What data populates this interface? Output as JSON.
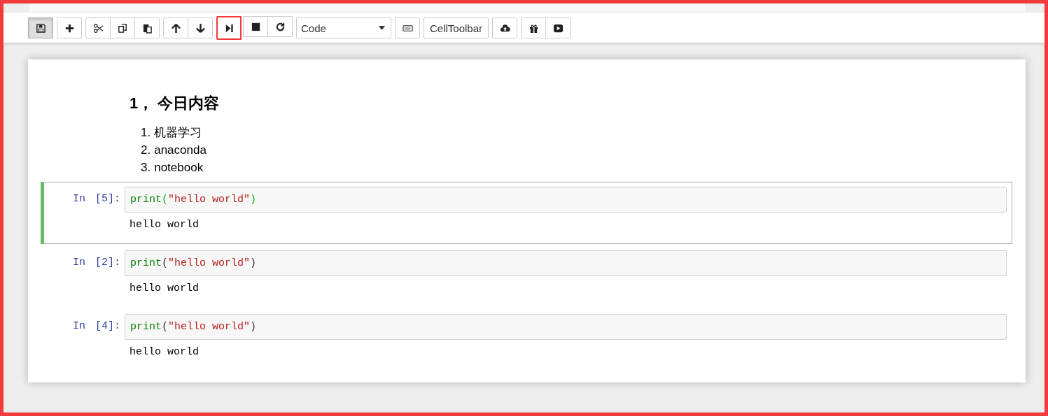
{
  "toolbar": {
    "groups": [
      {
        "buttons": [
          {
            "kind": "icon",
            "pressed": true,
            "highlighted": false
          }
        ]
      },
      {
        "buttons": [
          {
            "kind": "icon",
            "pressed": false,
            "highlighted": false
          }
        ]
      },
      {
        "buttons": [
          {
            "kind": "icon",
            "pressed": false,
            "highlighted": false
          },
          {
            "kind": "icon",
            "pressed": false,
            "highlighted": false
          },
          {
            "kind": "icon",
            "pressed": false,
            "highlighted": false
          }
        ]
      },
      {
        "buttons": [
          {
            "kind": "icon",
            "pressed": false,
            "highlighted": false
          },
          {
            "kind": "icon",
            "pressed": false,
            "highlighted": false
          }
        ]
      },
      {
        "buttons": [
          {
            "kind": "icon",
            "pressed": false,
            "highlighted": true
          },
          {
            "kind": "icon",
            "pressed": false,
            "highlighted": false
          },
          {
            "kind": "icon",
            "pressed": false,
            "highlighted": false
          }
        ]
      },
      {
        "buttons": [
          {
            "kind": "select",
            "value": "Code"
          }
        ]
      },
      {
        "buttons": [
          {
            "kind": "icon",
            "pressed": false,
            "highlighted": false
          }
        ]
      },
      {
        "buttons": [
          {
            "kind": "text",
            "label": "CellToolbar"
          }
        ]
      },
      {
        "buttons": [
          {
            "kind": "icon",
            "pressed": false,
            "highlighted": false
          }
        ]
      },
      {
        "buttons": [
          {
            "kind": "icon",
            "pressed": false,
            "highlighted": false
          },
          {
            "kind": "icon",
            "pressed": false,
            "highlighted": false
          }
        ]
      }
    ]
  },
  "markdown": {
    "heading": "1， 今日内容",
    "items": [
      {
        "number": "1.",
        "text": "机器学习"
      },
      {
        "number": "2.",
        "text": "anaconda"
      },
      {
        "number": "3.",
        "text": "notebook"
      }
    ]
  },
  "cells": [
    {
      "selected": true,
      "prompt": "In",
      "count": "[5]:",
      "func": "print",
      "open": "(",
      "string": "\"hello world\"",
      "close": ")",
      "output": "hello world"
    },
    {
      "selected": false,
      "prompt": "In",
      "count": "[2]:",
      "func": "print",
      "open": "(",
      "string": "\"hello world\"",
      "close": ")",
      "output": "hello world"
    },
    {
      "selected": false,
      "prompt": "In",
      "count": "[4]:",
      "func": "print",
      "open": "(",
      "string": "\"hello world\"",
      "close": ")",
      "output": "hello world"
    }
  ]
}
